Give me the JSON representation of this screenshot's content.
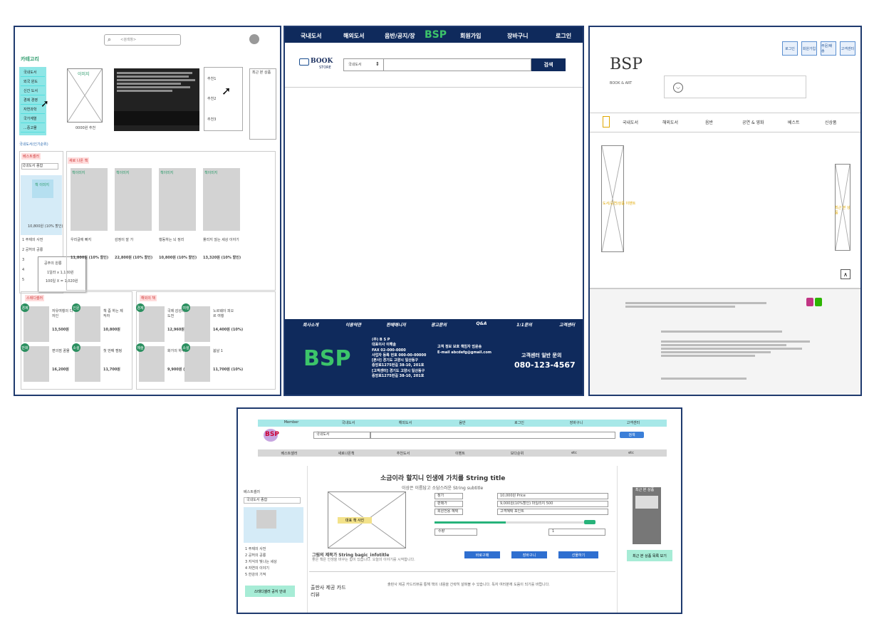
{
  "p1": {
    "search": {
      "placeholder": "<검색창>"
    },
    "category_title": "카테고리",
    "categories": [
      "국내도서",
      "외국 원도",
      "신간 도서",
      "경제 경영",
      "자연과학",
      "국가계열",
      "...중고몰"
    ],
    "image_label": "이미지",
    "image_price": "0000원 추천",
    "rec": [
      "추천1",
      "추천2",
      "추천3"
    ],
    "side_label": "최근 본 상품",
    "filter_select": "국내도서(인기순위)",
    "bestseller_tab": "베스트셀러",
    "bestseller_select": "국내도서 종합",
    "featured": {
      "label": "책 이미지",
      "price": "10,800원 (10% 할인)"
    },
    "mini_list": [
      "1 주제의 사전",
      "2 공허의 공룡",
      "3",
      "4",
      "5"
    ],
    "popup": {
      "title": "공주의 원룡",
      "line1": "1일라 x 1,130원",
      "line2": "100일 X = 1,020원"
    },
    "new_tab": "새로 나온 책",
    "new_books": [
      {
        "label": "책이미지",
        "title": "우리글에 빠지",
        "price": "11,800원 (10% 할인)"
      },
      {
        "label": "책이미지",
        "title": "감정이 잘 가",
        "price": "22,800원 (10% 할인)"
      },
      {
        "label": "책이미지",
        "title": "행동하는 뇌 정리",
        "price": "10,800원 (10% 할인)"
      },
      {
        "label": "책이미지",
        "title": "풀리지 않는 세상 이야기",
        "price": "13,320원 (10% 할인)"
      }
    ],
    "steady_tab": "스테디셀러",
    "steady_books": [
      {
        "badge": "경제",
        "title": "자유여행의 디자인",
        "price": "13,500원"
      },
      {
        "badge": "인문",
        "title": "책 좀 하는 제작자",
        "price": "10,800원"
      },
      {
        "badge": "만화",
        "title": "편의점 꿈물",
        "price": "16,200원"
      },
      {
        "badge": "소설",
        "title": "첫 번째 캠핑",
        "price": "11,700원"
      }
    ],
    "foreign_tab": "해외의 책",
    "foreign_books": [
      {
        "badge": "경제",
        "title": "국제 감성의 도전",
        "price": "12,960원 (10%)"
      },
      {
        "badge": "여행",
        "title": "노르웨이 피오르 여행",
        "price": "14,400원 (10%)"
      },
      {
        "badge": "예술",
        "title": "화가의 하루",
        "price": "9,900원 (10%)"
      },
      {
        "badge": "소설",
        "title": "봄날 1",
        "price": "11,700원 (10%)"
      }
    ]
  },
  "p2": {
    "nav": [
      "국내도서",
      "해외도서",
      "음반/공지/장",
      "회원가입",
      "장바구니",
      "로그인"
    ],
    "logo": "BSP",
    "store_logo_top": "BOOK",
    "store_logo_bottom": "STORE",
    "select": "국내도서",
    "search_button": "검색",
    "footer_nav": [
      "회사소개",
      "이용약관",
      "판매매니저",
      "광고문의",
      "Q&A",
      "1:1문의",
      "고객센터"
    ],
    "company": [
      "(주) B S P",
      "대표이사 이해솔",
      "FAX 02-000-0000",
      "사업자 등록 번호 000-00-00000",
      "[본사] 경기도 고양시 일산동구",
      "중앙로1275번길 38-10, 201호",
      "[고객센터] 경기도 고양시 일산동구",
      "중앙로1275번길 38-10, 201호"
    ],
    "privacy": [
      "고객 정보 보호 책임자 엄윤송",
      "E-mail abcdefg@gmail.com"
    ],
    "cs_label": "고객센터 일반 문의",
    "cs_phone": "080-123-4567"
  },
  "p3": {
    "top_buttons": [
      "로그인",
      "회원가입",
      "주문/배송",
      "고객센터"
    ],
    "logo": "BSP",
    "logo_sub": "BOOK & ART",
    "nav": [
      "국내도서",
      "해외도서",
      "음반",
      "공연 & 영화",
      "베스트",
      "신상품"
    ],
    "banner_left": "도서/공연/상품 이벤트",
    "banner_right": "최근 본 상품"
  },
  "p4": {
    "top_nav": [
      "Member",
      "국내도서",
      "해외도서",
      "음반",
      "로그인",
      "장바구니",
      "고객센터"
    ],
    "logo": "BSP",
    "select": "국내도서",
    "search_button": "검색",
    "sub_nav": [
      "베스트셀러",
      "새로나온책",
      "추천도서",
      "이벤트",
      "보다순위",
      "etc",
      "etc"
    ],
    "title": "소금이라 할지니 인생에 가치를 String title",
    "subtitle": "이상은 이름답고 소담스러운 String subtitle",
    "image_tag": "대표 책 사진",
    "form_labels": [
      "정가",
      "판매가",
      "회원전용 혜택"
    ],
    "form_values": [
      "10,000원 Price",
      "9,000원(10%할인) 마일리지 500",
      "고객혜택 포인트"
    ],
    "qty_label": "수량",
    "qty_value": "1",
    "desc_title": "그림의 제목가 String bagic_infotitle",
    "desc_text": "좋은 책은 인생을 바꾸는 힘이 있습니다. 오늘의 이야기를 시작합니다.",
    "buttons": [
      "바로구매",
      "장바구니",
      "선물하기"
    ],
    "sidebar_title": "베스트셀러",
    "sidebar_select": "국내도서 종합",
    "sidebar_items": [
      "1 주제의 사전",
      "2 공허의 공룡",
      "3 지식의 빛나는 세상",
      "4 자연의 이야기",
      "5 한강의 기적"
    ],
    "sidebar_note": "스테디셀러 공지 안내",
    "review_title": "출판사 제공 카드리뷰",
    "review_text": "출판사 제공 카드리뷰를 통해 책의 내용을 간략히 살펴볼 수 있습니다. 독자 여러분께 도움이 되기를 바랍니다.",
    "right_title": "최근 본 상품",
    "right_note": "최근 본 상품 목록 보기"
  }
}
